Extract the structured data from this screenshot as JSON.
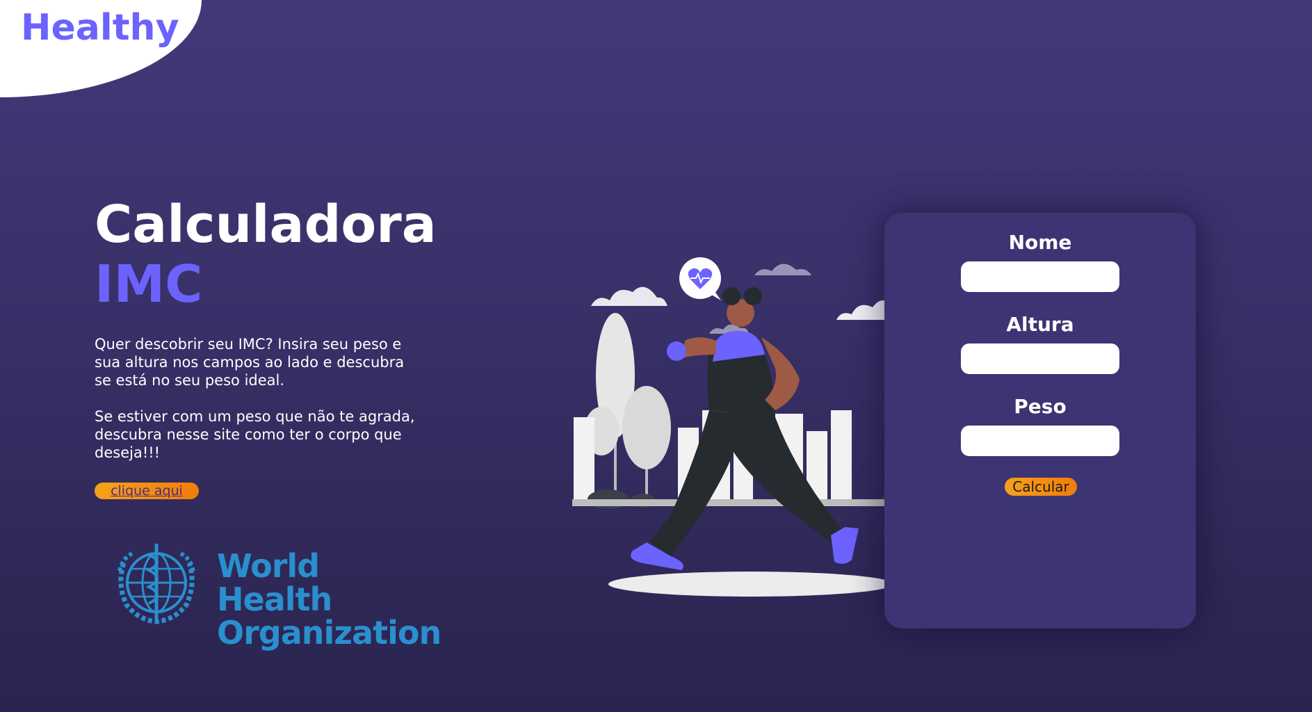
{
  "header": {
    "logo_text": "Healthy"
  },
  "hero": {
    "title_line1": "Calculadora",
    "title_line2": "IMC",
    "paragraph1": "Quer descobrir seu IMC? Insira seu peso e sua altura nos campos ao lado e descubra se está no seu peso ideal.",
    "paragraph2": "Se estiver com um peso que não te agrada, descubra nesse site como ter o corpo que deseja!!!",
    "cta_label": "clique aqui"
  },
  "partner_logo": {
    "line1": "World Health",
    "line2": "Organization"
  },
  "form": {
    "name_label": "Nome",
    "name_value": "",
    "height_label": "Altura",
    "height_value": "",
    "weight_label": "Peso",
    "weight_value": "",
    "submit_label": "Calcular"
  },
  "colors": {
    "accent": "#6c63ff",
    "button": "#f39019",
    "background": "#3a3270",
    "card": "#3d3474",
    "who_blue": "#2a8fce"
  }
}
